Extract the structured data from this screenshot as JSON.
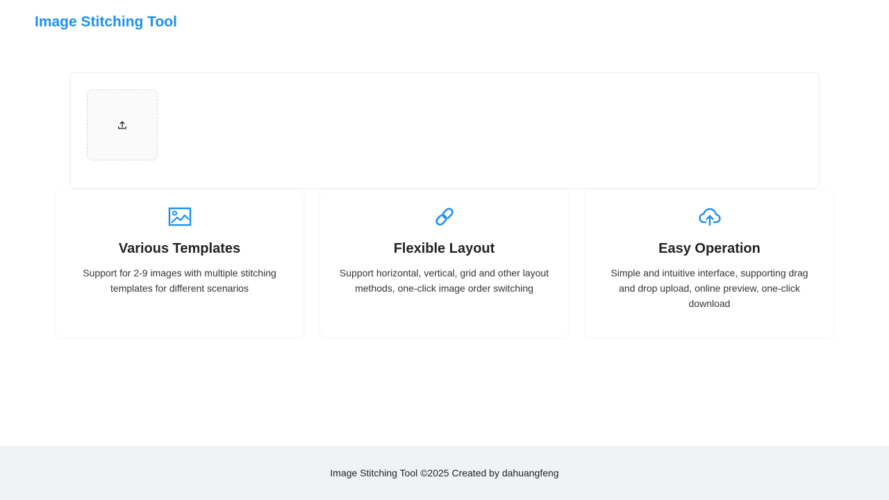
{
  "header": {
    "title": "Image Stitching Tool"
  },
  "upload": {
    "icon": "upload-icon"
  },
  "features": [
    {
      "icon": "image-icon",
      "title": "Various Templates",
      "description": "Support for 2-9 images with multiple stitching templates for different scenarios"
    },
    {
      "icon": "link-icon",
      "title": "Flexible Layout",
      "description": "Support horizontal, vertical, grid and other layout methods, one-click image order switching"
    },
    {
      "icon": "cloud-upload-icon",
      "title": "Easy Operation",
      "description": "Simple and intuitive interface, supporting drag and drop upload, online preview, one-click download"
    }
  ],
  "footer": {
    "text": "Image Stitching Tool ©2025 Created by dahuangfeng"
  },
  "colors": {
    "accent": "#1e8ff0",
    "footer_bg": "#f0f2f5",
    "text": "#222222"
  }
}
